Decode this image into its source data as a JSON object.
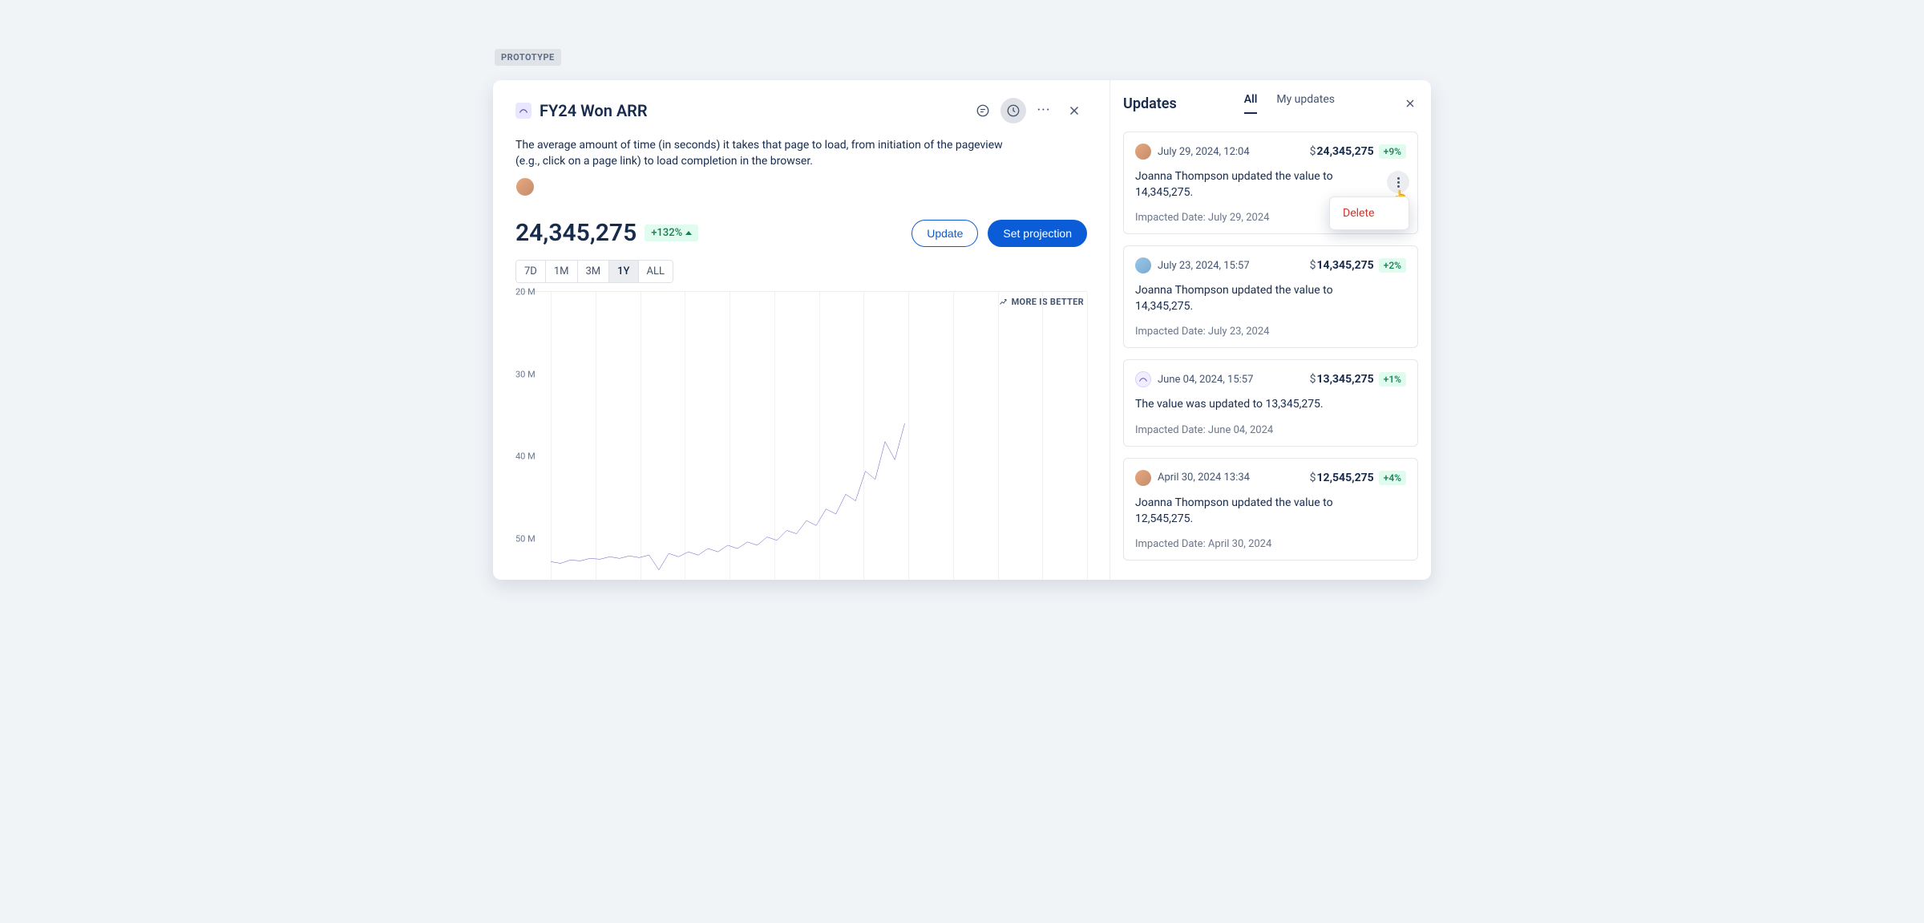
{
  "badge": "PROTOTYPE",
  "left": {
    "title": "FY24 Won ARR",
    "description": "The average amount of time (in seconds) it takes that page to load, from initiation of the pageview (e.g., click on a page link) to load completion in the browser.",
    "metric_value": "24,345,275",
    "delta": "+132%",
    "buttons": {
      "update": "Update",
      "projection": "Set projection"
    },
    "ranges": [
      "7D",
      "1M",
      "3M",
      "1Y",
      "ALL"
    ],
    "active_range": "1Y",
    "chart_note": "MORE IS BETTER",
    "y_ticks": [
      "50 M",
      "40 M",
      "30 M",
      "20 M"
    ]
  },
  "right": {
    "title": "Updates",
    "tabs": {
      "all": "All",
      "my": "My updates"
    },
    "menu_delete": "Delete",
    "updates": [
      {
        "date": "July 29, 2024, 12:04",
        "currency": "$",
        "value": "24,345,275",
        "pct": "+9%",
        "body": "Joanna Thompson updated the value to 14,345,275.",
        "impact": "Impacted Date: July 29, 2024",
        "has_menu": true,
        "avatar": "user1"
      },
      {
        "date": "July 23, 2024, 15:57",
        "currency": "$",
        "value": "14,345,275",
        "pct": "+2%",
        "body": "Joanna Thompson updated the value to 14,345,275.",
        "impact": "Impacted Date: July 23, 2024",
        "has_menu": false,
        "avatar": "user2"
      },
      {
        "date": "June 04, 2024, 15:57",
        "currency": "$",
        "value": "13,345,275",
        "pct": "+1%",
        "body": "The value was updated to 13,345,275.",
        "impact": "Impacted Date: June 04, 2024",
        "has_menu": false,
        "avatar": "system"
      },
      {
        "date": "April 30, 2024 13:34",
        "currency": "$",
        "value": "12,545,275",
        "pct": "+4%",
        "body": "Joanna Thompson updated the value to 12,545,275.",
        "impact": "Impacted Date: April 30, 2024",
        "has_menu": false,
        "avatar": "user1"
      }
    ]
  },
  "chart_data": {
    "type": "line",
    "title": "FY24 Won ARR",
    "ylabel": "",
    "xlabel": "",
    "ylim": [
      15,
      50
    ],
    "y_ticks": [
      20,
      30,
      40,
      50
    ],
    "unit": "M",
    "note": "MORE IS BETTER",
    "series": [
      {
        "name": "ARR",
        "color": "#6554c0",
        "x_index": [
          0,
          1,
          2,
          3,
          4,
          5,
          6,
          7,
          8,
          9,
          10,
          11,
          12,
          13,
          14,
          15,
          16,
          17,
          18,
          19,
          20,
          21,
          22,
          23,
          24,
          25,
          26,
          27,
          28,
          29,
          30,
          31,
          32,
          33,
          34,
          35,
          36
        ],
        "values": [
          17.2,
          17.0,
          17.4,
          17.3,
          17.6,
          17.5,
          17.8,
          17.6,
          17.9,
          17.7,
          18.0,
          16.2,
          18.2,
          17.8,
          18.4,
          18.0,
          18.8,
          18.4,
          19.2,
          18.8,
          19.6,
          19.2,
          20.2,
          19.8,
          21.0,
          20.6,
          22.2,
          21.6,
          23.6,
          23.0,
          25.4,
          24.6,
          28.2,
          27.2,
          31.8,
          29.6,
          34.0
        ]
      }
    ]
  }
}
